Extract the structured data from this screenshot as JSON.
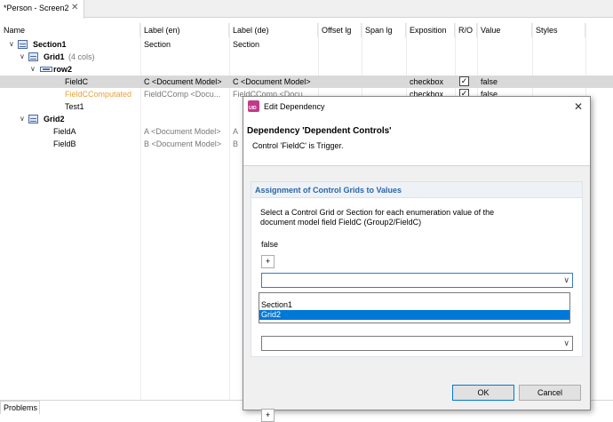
{
  "editor_tab": {
    "label": "*Person - Screen2",
    "close": "✕"
  },
  "columns": [
    "Name",
    "Label (en)",
    "Label (de)",
    "Offset lg",
    "Span lg",
    "Exposition",
    "R/O",
    "Value",
    "Styles"
  ],
  "rows": [
    {
      "name": "Section1",
      "label_en": "Section",
      "label_de": "Section",
      "exposition": "",
      "readonly": "",
      "value": ""
    },
    {
      "name": "Grid1",
      "suffix": "(4 cols)",
      "label_en": "",
      "label_de": "",
      "exposition": "",
      "readonly": "",
      "value": ""
    },
    {
      "name": "row2",
      "label_en": "",
      "label_de": "",
      "exposition": "",
      "readonly": "",
      "value": ""
    },
    {
      "name": "FieldC",
      "label_en": "C <Document Model>",
      "label_de": "C <Document Model>",
      "exposition": "checkbox",
      "readonly": "✓",
      "value": "false"
    },
    {
      "name": "FieldCComputated",
      "label_en": "FieldCComp <Docu...",
      "label_de": "FieldCComp <Docu...",
      "exposition": "checkbox",
      "readonly": "✓",
      "value": "false"
    },
    {
      "name": "Test1",
      "label_en": "",
      "label_de": "",
      "exposition": "",
      "readonly": "",
      "value": ""
    },
    {
      "name": "Grid2",
      "label_en": "",
      "label_de": "",
      "exposition": "",
      "readonly": "",
      "value": ""
    },
    {
      "name": "FieldA",
      "label_en": "A <Document Model>",
      "label_de": "A",
      "exposition": "",
      "readonly": "",
      "value": ""
    },
    {
      "name": "FieldB",
      "label_en": "B <Document Model>",
      "label_de": "B",
      "exposition": "",
      "readonly": "",
      "value": ""
    }
  ],
  "bottom_tab": "Problems",
  "dialog": {
    "title": "Edit Dependency",
    "icon_text": "UID",
    "close": "✕",
    "heading": "Dependency 'Dependent Controls'",
    "subheading": "Control 'FieldC' is Trigger.",
    "section_title": "Assignment of Control Grids to Values",
    "description": "Select a Control Grid or Section for each enumeration value of the document model field FieldC (Group2/FieldC)",
    "false_label": "false",
    "plus": "+",
    "combo1_value": "",
    "combo2_value": "",
    "dropdown_options": [
      "Section1",
      "Grid2"
    ],
    "ok": "OK",
    "cancel": "Cancel"
  },
  "colors": {
    "selected_row": "#d9d9d9",
    "orange_text": "#e6a23c",
    "section_title": "#2a66a6",
    "selection": "#0078d7"
  }
}
